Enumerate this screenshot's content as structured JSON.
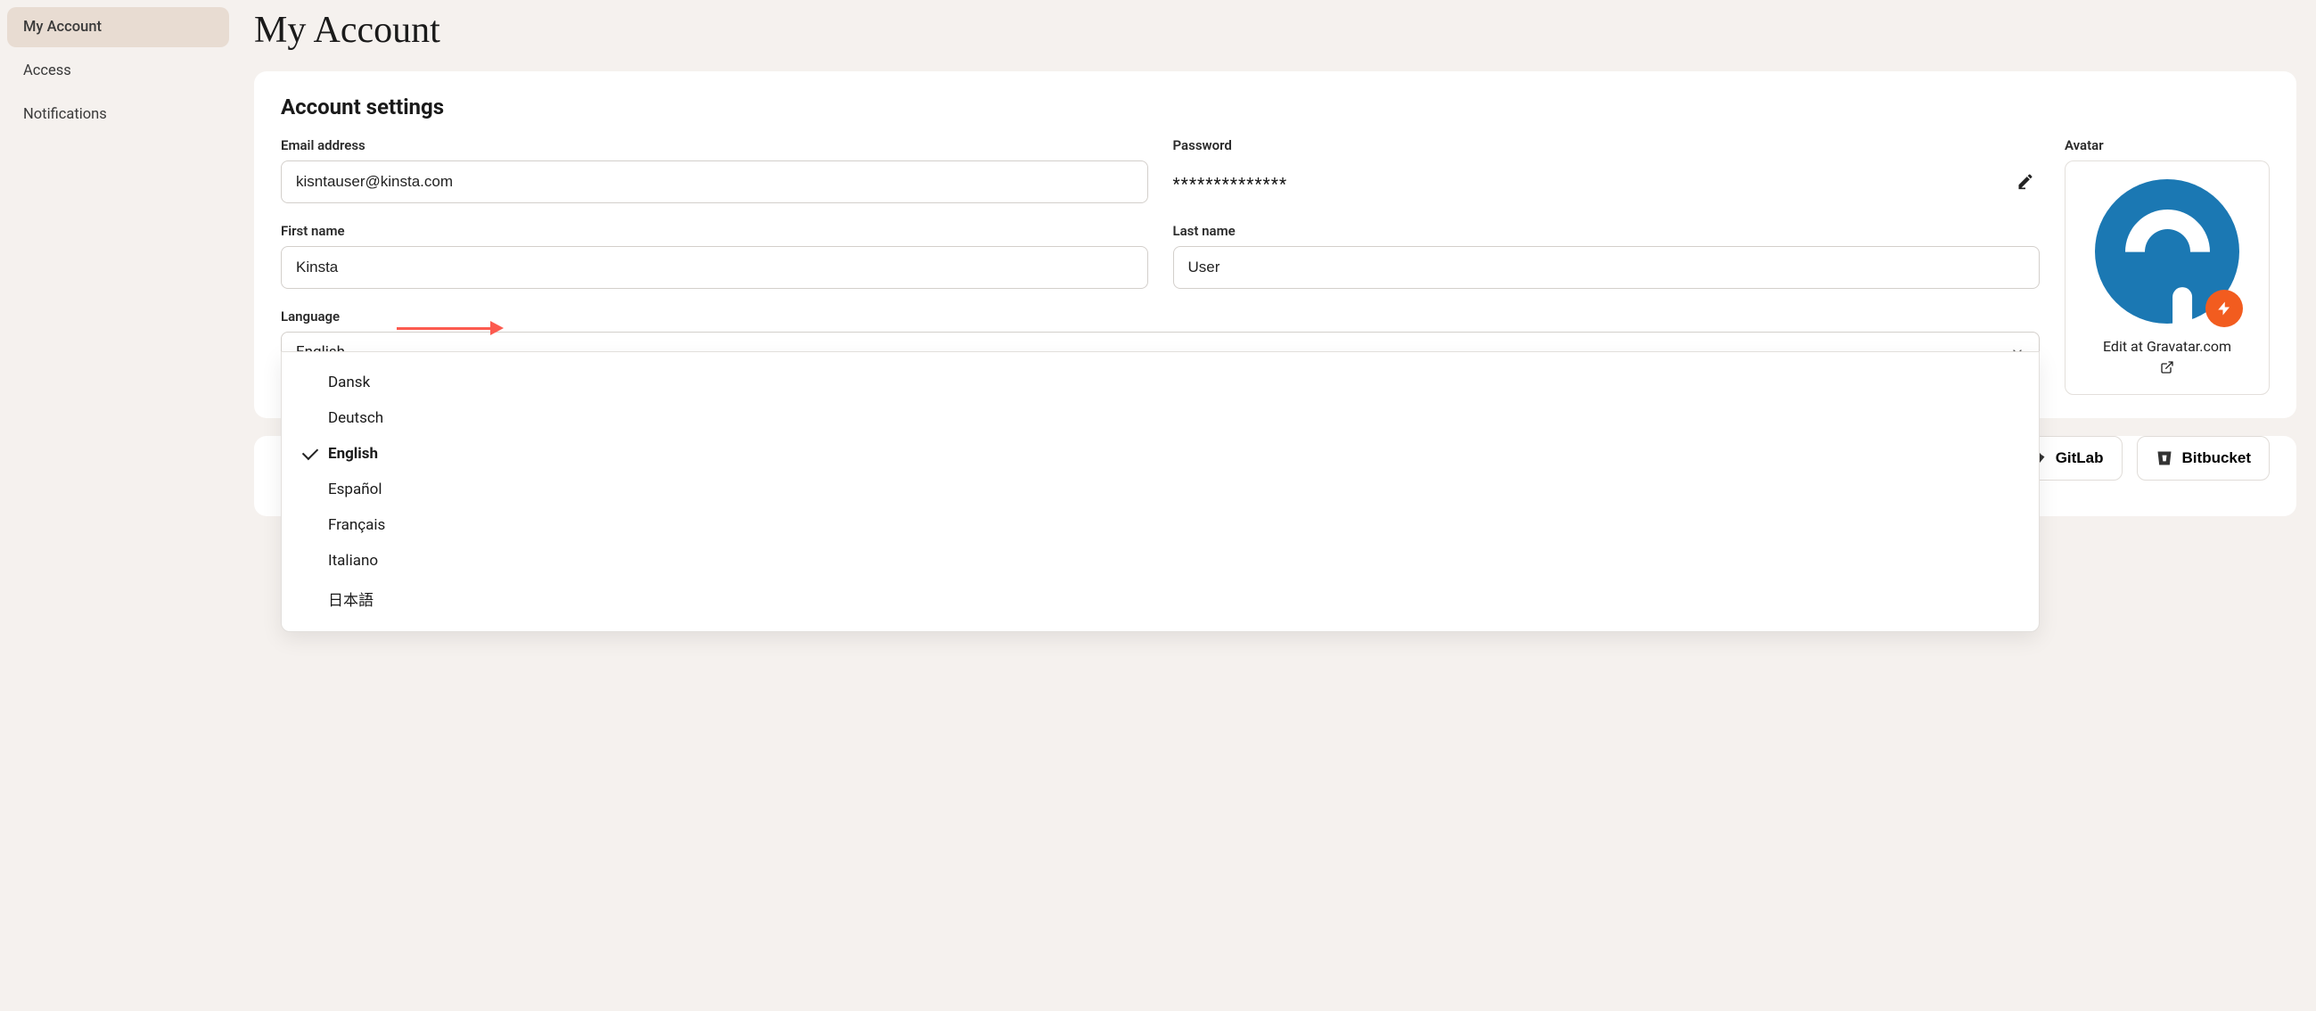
{
  "sidebar": {
    "items": [
      {
        "label": "My Account",
        "active": true
      },
      {
        "label": "Access",
        "active": false
      },
      {
        "label": "Notifications",
        "active": false
      }
    ]
  },
  "page": {
    "title": "My Account"
  },
  "settings": {
    "section_title": "Account settings",
    "email_label": "Email address",
    "email_value": "kisntauser@kinsta.com",
    "password_label": "Password",
    "password_mask": "**************",
    "firstname_label": "First name",
    "firstname_value": "Kinsta",
    "lastname_label": "Last name",
    "lastname_value": "User",
    "language_label": "Language",
    "language_selected": "English",
    "language_options": [
      {
        "label": "Dansk",
        "selected": false
      },
      {
        "label": "Deutsch",
        "selected": false
      },
      {
        "label": "English",
        "selected": true
      },
      {
        "label": "Español",
        "selected": false
      },
      {
        "label": "Français",
        "selected": false
      },
      {
        "label": "Italiano",
        "selected": false
      },
      {
        "label": "日本語",
        "selected": false
      }
    ]
  },
  "avatar": {
    "label": "Avatar",
    "edit_link": "Edit at Gravatar.com"
  },
  "connections": {
    "gitlab": "GitLab",
    "bitbucket": "Bitbucket"
  }
}
